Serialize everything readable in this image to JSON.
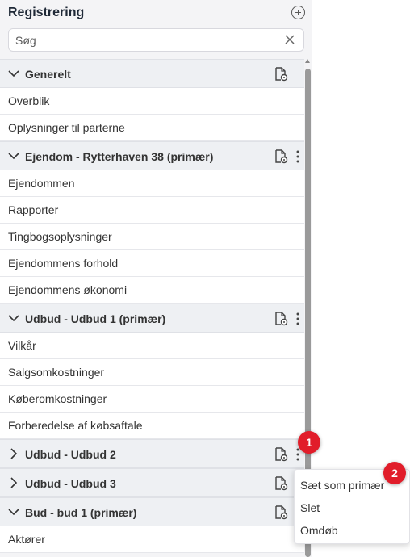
{
  "panel": {
    "title": "Registrering"
  },
  "search": {
    "placeholder": "Søg",
    "value": ""
  },
  "sections": [
    {
      "label": "Generelt",
      "expanded": true,
      "items": [
        "Overblik",
        "Oplysninger til parterne"
      ]
    },
    {
      "label": "Ejendom - Rytterhaven 38 (primær)",
      "expanded": true,
      "items": [
        "Ejendommen",
        "Rapporter",
        "Tingbogsoplysninger",
        "Ejendommens forhold",
        "Ejendommens økonomi"
      ]
    },
    {
      "label": "Udbud - Udbud 1 (primær)",
      "expanded": true,
      "items": [
        "Vilkår",
        "Salgsomkostninger",
        "Køberomkostninger",
        "Forberedelse af købsaftale"
      ]
    },
    {
      "label": "Udbud - Udbud 2",
      "expanded": false,
      "items": []
    },
    {
      "label": "Udbud - Udbud 3",
      "expanded": false,
      "items": []
    },
    {
      "label": "Bud - bud 1 (primær)",
      "expanded": true,
      "items": [
        "Aktører"
      ]
    }
  ],
  "context_menu": {
    "items": [
      "Sæt som primær",
      "Slet",
      "Omdøb"
    ]
  },
  "badges": [
    "1",
    "2"
  ],
  "colors": {
    "badge": "#e11d2a",
    "section_bg": "#eef0f3",
    "panel_bg": "#f4f4f6"
  }
}
